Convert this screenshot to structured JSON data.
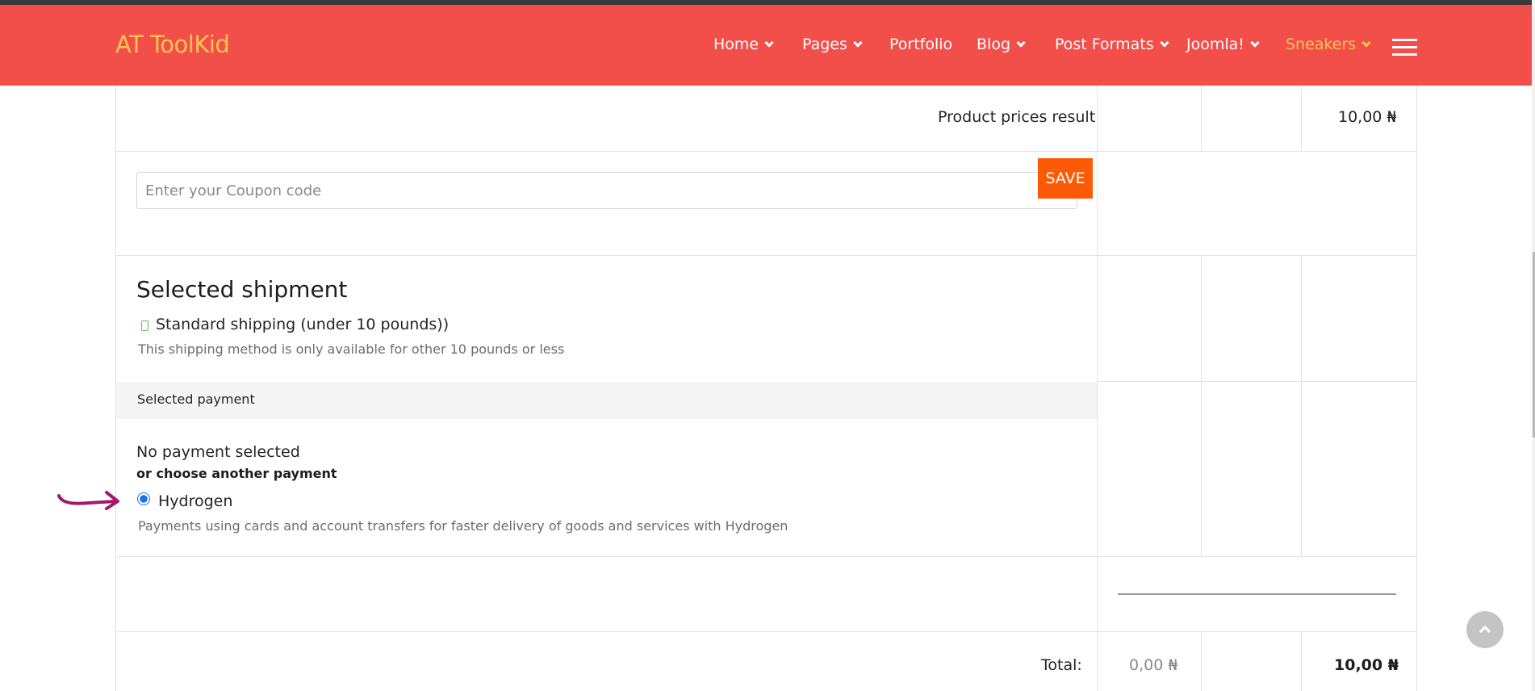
{
  "site": {
    "logo": "AT ToolKid"
  },
  "nav": {
    "items": [
      {
        "label": "Home",
        "dropdown": true
      },
      {
        "label": "Pages",
        "dropdown": true
      },
      {
        "label": "Portfolio",
        "dropdown": false
      },
      {
        "label": "Blog",
        "dropdown": true
      },
      {
        "label": "Post Formats",
        "dropdown": true
      },
      {
        "label": "Joomla!",
        "dropdown": true
      },
      {
        "label": "Sneakers",
        "dropdown": true,
        "active": true
      }
    ],
    "menu_icon": "hamburger-icon"
  },
  "cart": {
    "product_prices_label": "Product prices result",
    "product_prices_value": "10,00 ₦",
    "coupon": {
      "placeholder": "Enter your Coupon code",
      "value": "",
      "save_label": "SAVE"
    },
    "shipment": {
      "heading": "Selected shipment",
      "method": "Standard shipping (under 10 pounds))",
      "description": "This shipping method is only available for other 10 pounds or less",
      "icon": "truck-icon"
    },
    "payment": {
      "heading": "Selected payment",
      "none_selected": "No payment selected",
      "choose_another": "or choose another payment",
      "option_label": "Hydrogen",
      "option_description": "Payments using cards and account transfers for faster delivery of goods and services with Hydrogen"
    },
    "total": {
      "label": "Total:",
      "tax": "0,00 ₦",
      "value": "10,00 ₦"
    }
  },
  "colors": {
    "header_bg": "#f24e4a",
    "accent_yellow": "#fcc552",
    "save_button": "#fd5a08",
    "annotation_arrow": "#a3186a"
  }
}
